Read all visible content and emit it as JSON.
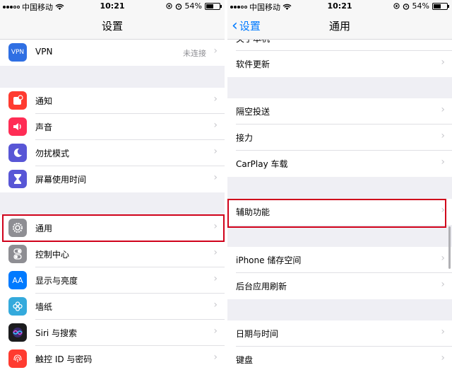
{
  "colors": {
    "highlight": "#d0021b",
    "back_blue": "#007aff",
    "vpn_icon": "#2f6fe3",
    "notify_icon": "#ff3b30",
    "sound_icon": "#ff2d55",
    "dnd_icon": "#5856d6",
    "screentime_icon": "#5856d6",
    "general_icon": "#8e8e93",
    "control_icon": "#8e8e93",
    "display_icon": "#007aff",
    "wallpaper_icon": "#34aadc",
    "siri_icon": "#1c1c1e",
    "touchid_icon": "#ff3b30"
  },
  "left": {
    "status": {
      "carrier": "中国移动",
      "time": "10:21",
      "battery": "54%",
      "battery_level": 0.54
    },
    "nav_title": "设置",
    "vpn": {
      "icon_text": "VPN",
      "label": "VPN",
      "value": "未连接"
    },
    "group2": [
      {
        "label": "通知",
        "icon": "notifications-icon"
      },
      {
        "label": "声音",
        "icon": "sound-icon"
      },
      {
        "label": "勿扰模式",
        "icon": "moon-icon"
      },
      {
        "label": "屏幕使用时间",
        "icon": "hourglass-icon"
      }
    ],
    "group3": [
      {
        "label": "通用",
        "icon": "gear-icon"
      },
      {
        "label": "控制中心",
        "icon": "toggles-icon"
      },
      {
        "label": "显示与亮度",
        "icon_text": "AA",
        "icon": "display-icon"
      },
      {
        "label": "墙纸",
        "icon": "flower-icon"
      },
      {
        "label": "Siri 与搜索",
        "icon": "siri-icon"
      },
      {
        "label": "触控 ID 与密码",
        "icon": "fingerprint-icon"
      }
    ]
  },
  "right": {
    "status": {
      "carrier": "中国移动",
      "time": "10:21",
      "battery": "54%",
      "battery_level": 0.54
    },
    "back_label": "设置",
    "nav_title": "通用",
    "partial_row": "关于本机",
    "rows_a": [
      "软件更新"
    ],
    "rows_b": [
      "隔空投送",
      "接力",
      "CarPlay 车载"
    ],
    "rows_c": [
      "辅助功能"
    ],
    "rows_d": [
      "iPhone 储存空间",
      "后台应用刷新"
    ],
    "rows_e": [
      "日期与时间",
      "键盘"
    ]
  }
}
